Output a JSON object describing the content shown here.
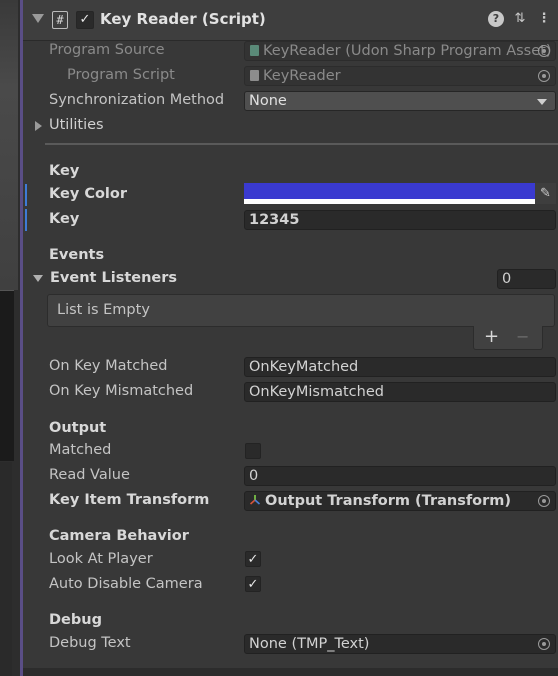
{
  "component": {
    "title": "Key Reader (Script)",
    "script_glyph": "#",
    "enabled_check": "✓",
    "header_icons": [
      "help-icon",
      "preset-icon",
      "menu-icon"
    ]
  },
  "fields": {
    "program_source_label": "Program Source",
    "program_source_value": "KeyReader (Udon Sharp Program Asset)",
    "program_script_label": "Program Script",
    "program_script_value": "KeyReader",
    "sync_method_label": "Synchronization Method",
    "sync_method_value": "None",
    "utilities_label": "Utilities"
  },
  "key_section": {
    "header": "Key",
    "key_color_label": "Key Color",
    "key_color_value": "#3a3ad0",
    "key_label": "Key",
    "key_value": "12345"
  },
  "events_section": {
    "header": "Events",
    "listeners_label": "Event Listeners",
    "listeners_count": "0",
    "list_empty_text": "List is Empty",
    "add_glyph": "+",
    "remove_glyph": "−",
    "on_matched_label": "On Key Matched",
    "on_matched_value": "OnKeyMatched",
    "on_mismatched_label": "On Key Mismatched",
    "on_mismatched_value": "OnKeyMismatched"
  },
  "output_section": {
    "header": "Output",
    "matched_label": "Matched",
    "read_value_label": "Read Value",
    "read_value_value": "0",
    "key_item_label": "Key Item Transform",
    "key_item_value": "Output Transform (Transform)"
  },
  "camera_section": {
    "header": "Camera Behavior",
    "look_label": "Look At Player",
    "look_check": "✓",
    "auto_label": "Auto Disable Camera",
    "auto_check": "✓"
  },
  "debug_section": {
    "header": "Debug",
    "debug_text_label": "Debug Text",
    "debug_text_value": "None (TMP_Text)"
  },
  "colors": {
    "accent_line": "#5a4e86",
    "modified_marker": "#3e7bd6",
    "key_color": "#3a3ad0"
  }
}
